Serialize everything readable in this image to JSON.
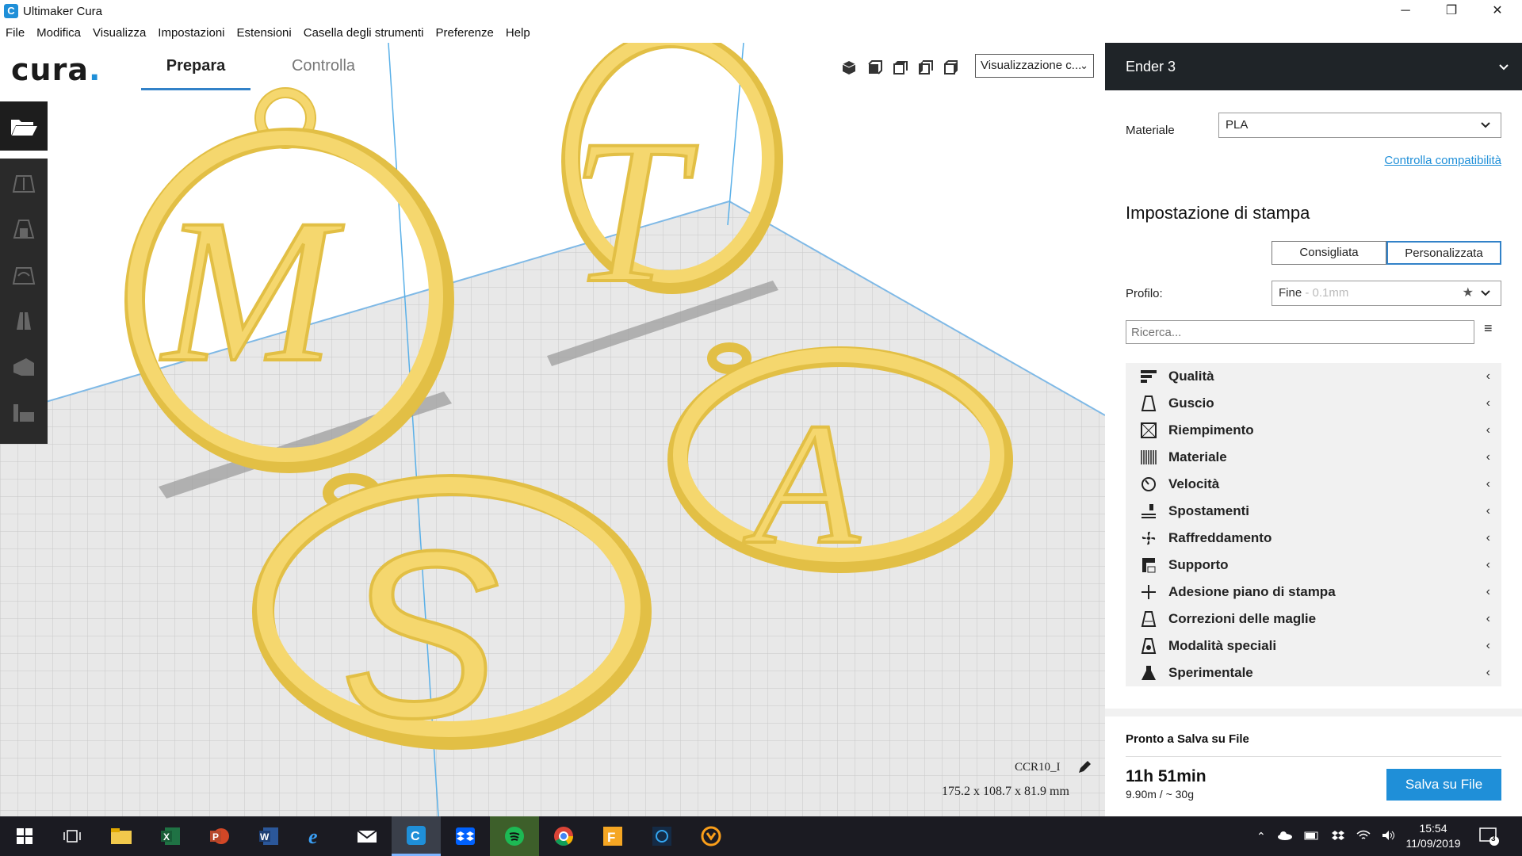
{
  "window": {
    "title": "Ultimaker Cura",
    "app_icon_letter": "C",
    "minimize": "─",
    "maximize": "❐",
    "close": "✕"
  },
  "menu": [
    "File",
    "Modifica",
    "Visualizza",
    "Impostazioni",
    "Estensioni",
    "Casella degli strumenti",
    "Preferenze",
    "Help"
  ],
  "toolbar": {
    "logo": "cura",
    "logo_dot": ".",
    "stages": [
      "Prepara",
      "Controlla"
    ],
    "view_select": "Visualizzazione c...",
    "view_icons": [
      "view-3d-icon",
      "view-front-icon",
      "view-top-icon",
      "view-left-icon",
      "view-right-icon"
    ]
  },
  "left_tools": [
    "open-file-icon",
    "move-icon",
    "scale-icon",
    "rotate-icon",
    "mirror-icon",
    "per-model-settings-icon",
    "support-blocker-icon"
  ],
  "viewport": {
    "object_name": "CCR10_I",
    "dimensions": "175.2 x 108.7 x 81.9 mm"
  },
  "panel": {
    "printer": "Ender 3",
    "material_label": "Materiale",
    "material_value": "PLA",
    "compat_link": "Controlla compatibilità",
    "print_setup_title": "Impostazione di stampa",
    "mode_recommended": "Consigliata",
    "mode_custom": "Personalizzata",
    "profile_label": "Profilo:",
    "profile_value": "Fine",
    "profile_hint": " - 0.1mm",
    "search_placeholder": "Ricerca...",
    "categories": [
      {
        "label": "Qualità",
        "icon": "quality-icon"
      },
      {
        "label": "Guscio",
        "icon": "shell-icon"
      },
      {
        "label": "Riempimento",
        "icon": "infill-icon"
      },
      {
        "label": "Materiale",
        "icon": "material-icon"
      },
      {
        "label": "Velocità",
        "icon": "speed-icon"
      },
      {
        "label": "Spostamenti",
        "icon": "travel-icon"
      },
      {
        "label": "Raffreddamento",
        "icon": "cooling-icon"
      },
      {
        "label": "Supporto",
        "icon": "support-icon"
      },
      {
        "label": "Adesione piano di stampa",
        "icon": "adhesion-icon"
      },
      {
        "label": "Correzioni delle maglie",
        "icon": "mesh-fixes-icon"
      },
      {
        "label": "Modalità speciali",
        "icon": "special-modes-icon"
      },
      {
        "label": "Sperimentale",
        "icon": "experimental-icon"
      }
    ],
    "ready_label": "Pronto a Salva su File",
    "print_time": "11h 51min",
    "usage": "9.90m / ~ 30g",
    "save_button": "Salva su File"
  },
  "taskbar": {
    "time": "15:54",
    "date": "11/09/2019",
    "notifications": "3"
  },
  "colors": {
    "accent": "#1f8fd8",
    "model": "#f5d76e",
    "model_shadow": "#e2bf45",
    "dark": "#1f2428"
  }
}
